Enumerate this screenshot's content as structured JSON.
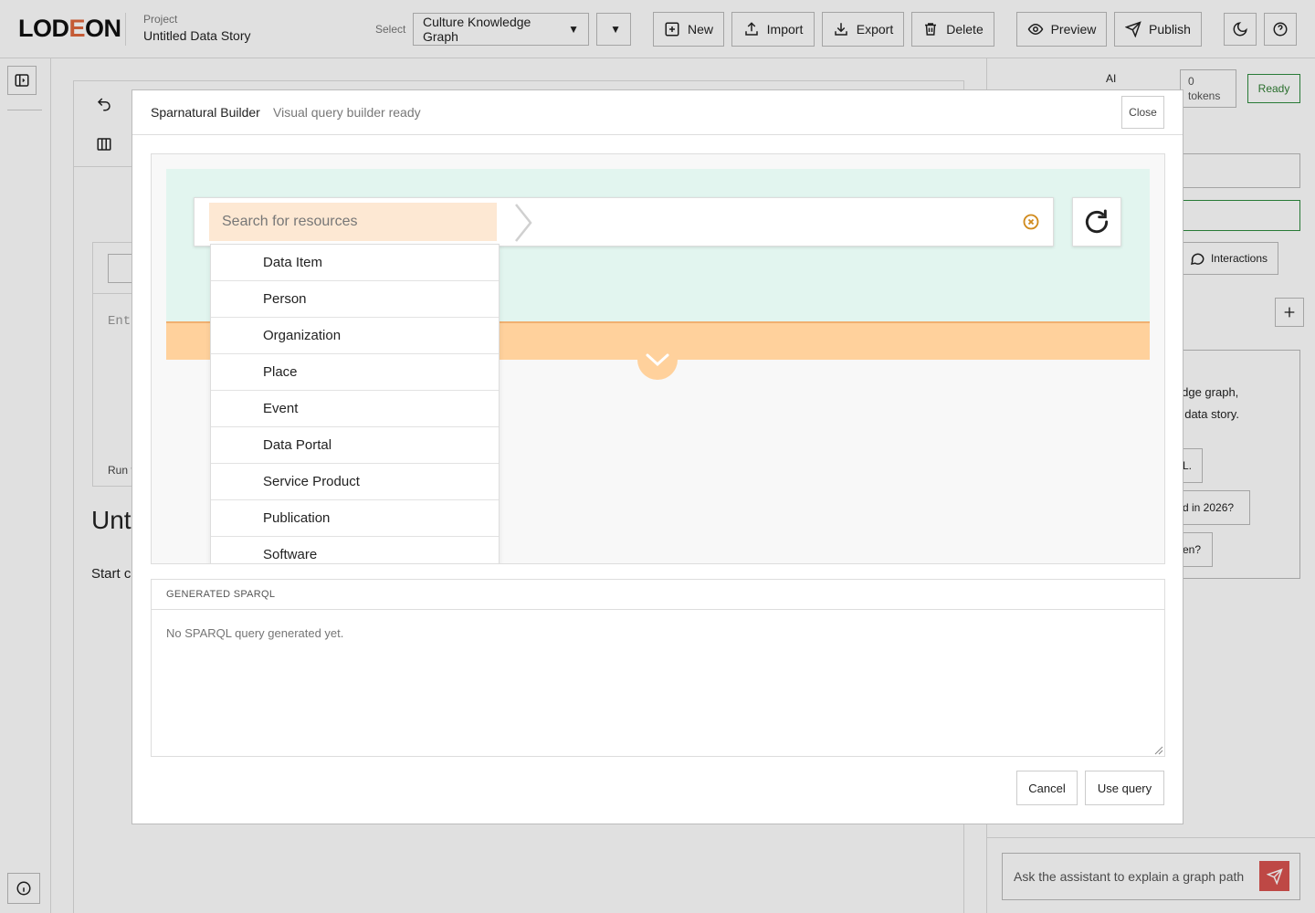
{
  "header": {
    "logo_text_a": "LOD",
    "logo_text_b": "E",
    "logo_text_c": "ON",
    "project_label": "Project",
    "project_name": "Untitled Data Story",
    "select_label": "Select",
    "graph_select_value": "Culture Knowledge Graph",
    "buttons": {
      "new": "New",
      "import": "Import",
      "export": "Export",
      "delete": "Delete",
      "preview": "Preview",
      "publish": "Publish"
    }
  },
  "workspace": {
    "editor_placeholder": "Ent",
    "run_label": "Run t",
    "story_title": "Unt",
    "story_sub": "Start c"
  },
  "right_panel": {
    "ai_label": "AI",
    "tokens_count": "0",
    "tokens_label": "tokens",
    "status": "Ready",
    "interactions_label": "Interactions",
    "assistant_line_1": "ledge graph,",
    "assistant_line_2": "t data story.",
    "suggestion_1": "L.",
    "suggestion_2": "d in 2026?",
    "suggestion_3": "en?",
    "chat_placeholder": "Ask the assistant to explain a graph path"
  },
  "modal": {
    "title": "Sparnatural Builder",
    "status": "Visual query builder ready",
    "close_label": "Close",
    "search_placeholder": "Search for resources",
    "resource_types": [
      "Data Item",
      "Person",
      "Organization",
      "Place",
      "Event",
      "Data Portal",
      "Service Product",
      "Publication",
      "Software"
    ],
    "sparql_label": "GENERATED SPARQL",
    "sparql_placeholder": "No SPARQL query generated yet.",
    "cancel_label": "Cancel",
    "use_label": "Use query"
  },
  "colors": {
    "accent_orange": "#ffd19c",
    "builder_green": "#e2f5ef",
    "search_bg": "#fde8d3",
    "send_red": "#d9534f",
    "ready_green": "#2e7d32"
  },
  "icons": [
    "undo-icon",
    "columns-icon",
    "plus-square-icon",
    "upload-icon",
    "download-icon",
    "trash-icon",
    "eye-icon",
    "send-icon",
    "moon-icon",
    "help-icon",
    "sidebar-toggle-icon",
    "info-icon",
    "clear-circle-icon",
    "refresh-icon",
    "chevron-down-icon",
    "chat-bubble-icon",
    "plus-icon"
  ]
}
